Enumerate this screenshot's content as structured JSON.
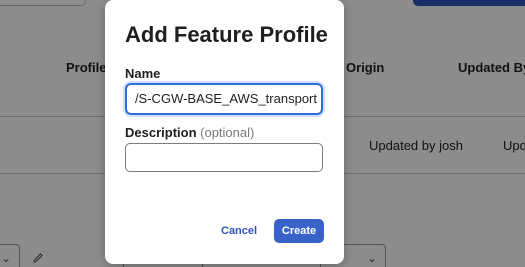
{
  "background": {
    "table_headers": [
      "Profile",
      "Origin",
      "Updated By"
    ],
    "row_cells": [
      "Updated by josh",
      "Upd"
    ]
  },
  "modal": {
    "title": "Add Feature Profile",
    "name_label": "Name",
    "name_value": "/S-CGW-BASE_AWS_transport",
    "description_label": "Description",
    "description_optional": "(optional)",
    "description_value": "",
    "cancel_label": "Cancel",
    "create_label": "Create"
  },
  "colors": {
    "accent": "#3a63c9",
    "focus_border": "#2f6fd1",
    "primary_button_bg": "#2f54b8"
  },
  "icons": {
    "edit": "pencil-icon",
    "dropdown": "chevron-down-icon"
  }
}
